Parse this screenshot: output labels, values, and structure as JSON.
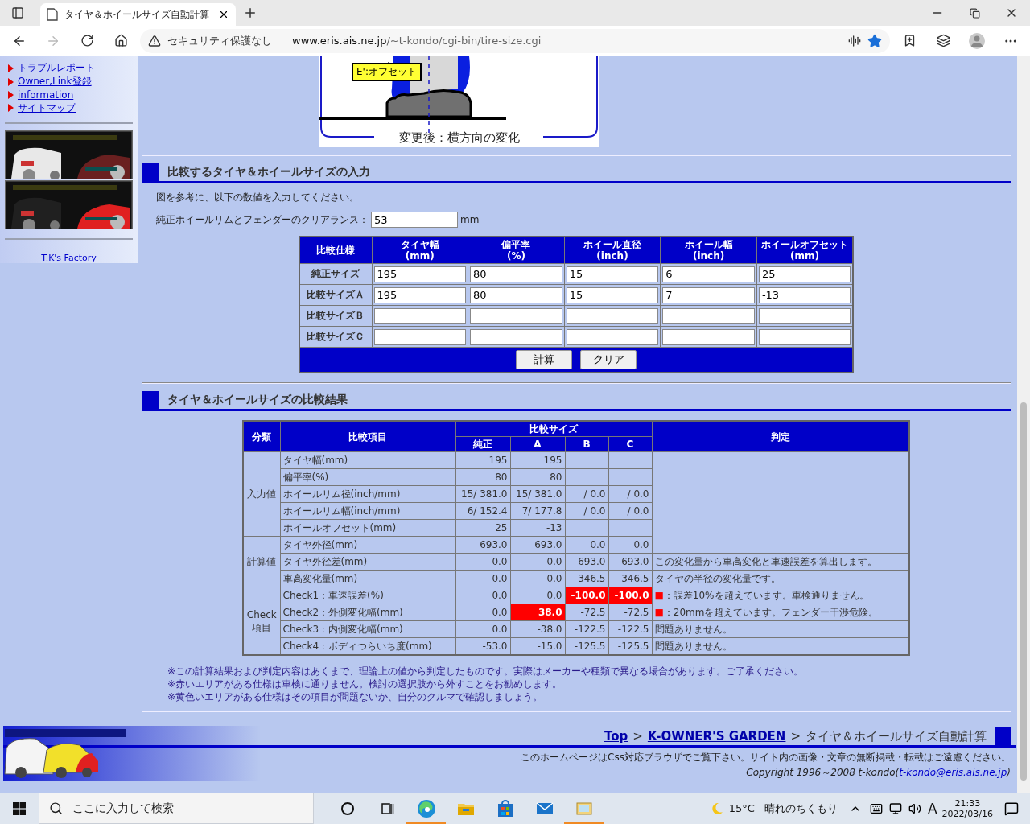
{
  "browser": {
    "tab_title": "タイヤ＆ホイールサイズ自動計算",
    "security": "セキュリティ保護なし",
    "url_host": "www.eris.ais.ne.jp",
    "url_path": "/~t-kondo/cgi-bin/tire-size.cgi",
    "favorited": true
  },
  "sidebar": {
    "links": [
      "トラブルレポート",
      "Owner,Link登録",
      "information",
      "サイトマップ"
    ],
    "footer_link": "T.K's Factory"
  },
  "diagram": {
    "callout": "E':オフセット",
    "caption": "変更後：横方向の変化"
  },
  "input_section": {
    "title": "比較するタイヤ＆ホイールサイズの入力",
    "instruction": "図を参考に、以下の数値を入力してください。",
    "clearance": {
      "label": "純正ホイールリムとフェンダーのクリアランス：",
      "value": "53",
      "unit": "mm"
    },
    "corner": "比較仕様",
    "columns": [
      {
        "label": "タイヤ幅",
        "unit": "(mm)"
      },
      {
        "label": "偏平率",
        "unit": "(%)"
      },
      {
        "label": "ホイール直径",
        "unit": "(inch)"
      },
      {
        "label": "ホイール幅",
        "unit": "(inch)"
      },
      {
        "label": "ホイールオフセット",
        "unit": "(mm)"
      }
    ],
    "rows": [
      {
        "label": "純正サイズ",
        "values": [
          "195",
          "80",
          "15",
          "6",
          "25"
        ]
      },
      {
        "label": "比較サイズＡ",
        "values": [
          "195",
          "80",
          "15",
          "7",
          "-13"
        ]
      },
      {
        "label": "比較サイズＢ"
      },
      {
        "label": "比較サイズＣ"
      }
    ],
    "buttons": [
      "計算",
      "クリア"
    ]
  },
  "result_section": {
    "title": "タイヤ＆ホイールサイズの比較結果",
    "headers": {
      "category": "分類",
      "item": "比較項目",
      "sizes": "比較サイズ",
      "judgement": "判定",
      "columns": [
        "純正",
        "A",
        "B",
        "C"
      ]
    },
    "groups": [
      {
        "label": "入力値",
        "rows": [
          {
            "item": "タイヤ幅(mm)",
            "cells": [
              {
                "text": "195",
                "alert": false
              },
              {
                "text": "195",
                "alert": false
              },
              {
                "alert": false
              },
              {
                "alert": false
              }
            ]
          },
          {
            "item": "偏平率(%)",
            "cells": [
              {
                "text": "80",
                "alert": false
              },
              {
                "text": "80",
                "alert": false
              },
              {
                "alert": false
              },
              {
                "alert": false
              }
            ]
          },
          {
            "item": "ホイールリム径(inch/mm)",
            "cells": [
              {
                "text": "15/ 381.0",
                "alert": false
              },
              {
                "text": "15/ 381.0",
                "alert": false
              },
              {
                "text": "/ 0.0",
                "alert": false
              },
              {
                "text": "/ 0.0",
                "alert": false
              }
            ]
          },
          {
            "item": "ホイールリム幅(inch/mm)",
            "cells": [
              {
                "text": "6/ 152.4",
                "alert": false
              },
              {
                "text": "7/ 177.8",
                "alert": false
              },
              {
                "text": "/ 0.0",
                "alert": false
              },
              {
                "text": "/ 0.0",
                "alert": false
              }
            ]
          },
          {
            "item": "ホイールオフセット(mm)",
            "cells": [
              {
                "text": "25",
                "alert": false
              },
              {
                "text": "-13",
                "alert": false
              },
              {
                "alert": false
              },
              {
                "alert": false
              }
            ]
          }
        ]
      },
      {
        "label": "計算値",
        "rows": [
          {
            "item": "タイヤ外径(mm)",
            "cells": [
              {
                "text": "693.0",
                "alert": false
              },
              {
                "text": "693.0",
                "alert": false
              },
              {
                "text": "0.0",
                "alert": false
              },
              {
                "text": "0.0",
                "alert": false
              }
            ]
          },
          {
            "item": "タイヤ外径差(mm)",
            "cells": [
              {
                "text": "0.0",
                "alert": false
              },
              {
                "text": "0.0",
                "alert": false
              },
              {
                "text": "-693.0",
                "alert": false
              },
              {
                "text": "-693.0",
                "alert": false
              }
            ],
            "judgement": {
              "text": "この変化量から車高変化と車速誤差を算出します。"
            }
          },
          {
            "item": "車高変化量(mm)",
            "cells": [
              {
                "text": "0.0",
                "alert": false
              },
              {
                "text": "0.0",
                "alert": false
              },
              {
                "text": "-346.5",
                "alert": false
              },
              {
                "text": "-346.5",
                "alert": false
              }
            ],
            "judgement": {
              "text": "タイヤの半径の変化量です。"
            }
          }
        ]
      },
      {
        "label": "Check項目",
        "rows": [
          {
            "item": "Check1：車速誤差(%)",
            "cells": [
              {
                "text": "0.0",
                "alert": false
              },
              {
                "text": "0.0",
                "alert": false
              },
              {
                "text": "-100.0",
                "alert": true
              },
              {
                "text": "-100.0",
                "alert": true
              }
            ],
            "judgement": {
              "marker": "■",
              "text": "：誤差10%を超えています。車検通りません。"
            }
          },
          {
            "item": "Check2：外側変化幅(mm)",
            "cells": [
              {
                "text": "0.0",
                "alert": false
              },
              {
                "text": "38.0",
                "alert": true
              },
              {
                "text": "-72.5",
                "alert": false
              },
              {
                "text": "-72.5",
                "alert": false
              }
            ],
            "judgement": {
              "marker": "■",
              "text": "：20mmを超えています。フェンダー干渉危険。"
            }
          },
          {
            "item": "Check3：内側変化幅(mm)",
            "cells": [
              {
                "text": "0.0",
                "alert": false
              },
              {
                "text": "-38.0",
                "alert": false
              },
              {
                "text": "-122.5",
                "alert": false
              },
              {
                "text": "-122.5",
                "alert": false
              }
            ],
            "judgement": {
              "text": "問題ありません。"
            }
          },
          {
            "item": "Check4：ボディつらいち度(mm)",
            "cells": [
              {
                "text": "-53.0",
                "alert": false
              },
              {
                "text": "-15.0",
                "alert": false
              },
              {
                "text": "-125.5",
                "alert": false
              },
              {
                "text": "-125.5",
                "alert": false
              }
            ],
            "judgement": {
              "text": "問題ありません。"
            }
          }
        ]
      }
    ],
    "notes": [
      "※この計算結果および判定内容はあくまで、理論上の値から判定したものです。実際はメーカーや種類で異なる場合があります。ご了承ください。",
      "※赤いエリアがある仕様は車検に通りません。検討の選択肢から外すことをお勧めします。",
      "※黄色いエリアがある仕様はその項目が問題ないか、自分のクルマで確認しましょう。"
    ]
  },
  "footer": {
    "breadcrumb": [
      {
        "kind": "link",
        "text": "Top"
      },
      {
        "kind": "separator",
        "text": ">"
      },
      {
        "kind": "link",
        "text": "K-OWNER'S GARDEN"
      },
      {
        "kind": "separator",
        "text": ">"
      },
      {
        "kind": "current",
        "text": "タイヤ＆ホイールサイズ自動計算"
      }
    ],
    "notice": "このホームページはCss対応ブラウザでご覧下さい。サイト内の画像・文章の無断掲載・転載はご遠慮ください。",
    "copyright": "Copyright 1996～2008 t-kondo(",
    "email": "t-kondo@eris.ais.ne.jp",
    "copyright_end": ")"
  },
  "taskbar": {
    "search_placeholder": "ここに入力して検索",
    "apps": [
      {
        "kind": "cortana",
        "running": false
      },
      {
        "kind": "taskview",
        "running": false
      },
      {
        "kind": "edge",
        "running": true
      },
      {
        "kind": "explorer",
        "running": false
      },
      {
        "kind": "store",
        "running": false
      },
      {
        "kind": "mail",
        "running": false
      },
      {
        "kind": "photos",
        "running": true
      }
    ],
    "temperature": "15°C",
    "weather": "晴れのちくもり",
    "ime": "A",
    "time": "21:33",
    "date": "2022/03/16"
  }
}
